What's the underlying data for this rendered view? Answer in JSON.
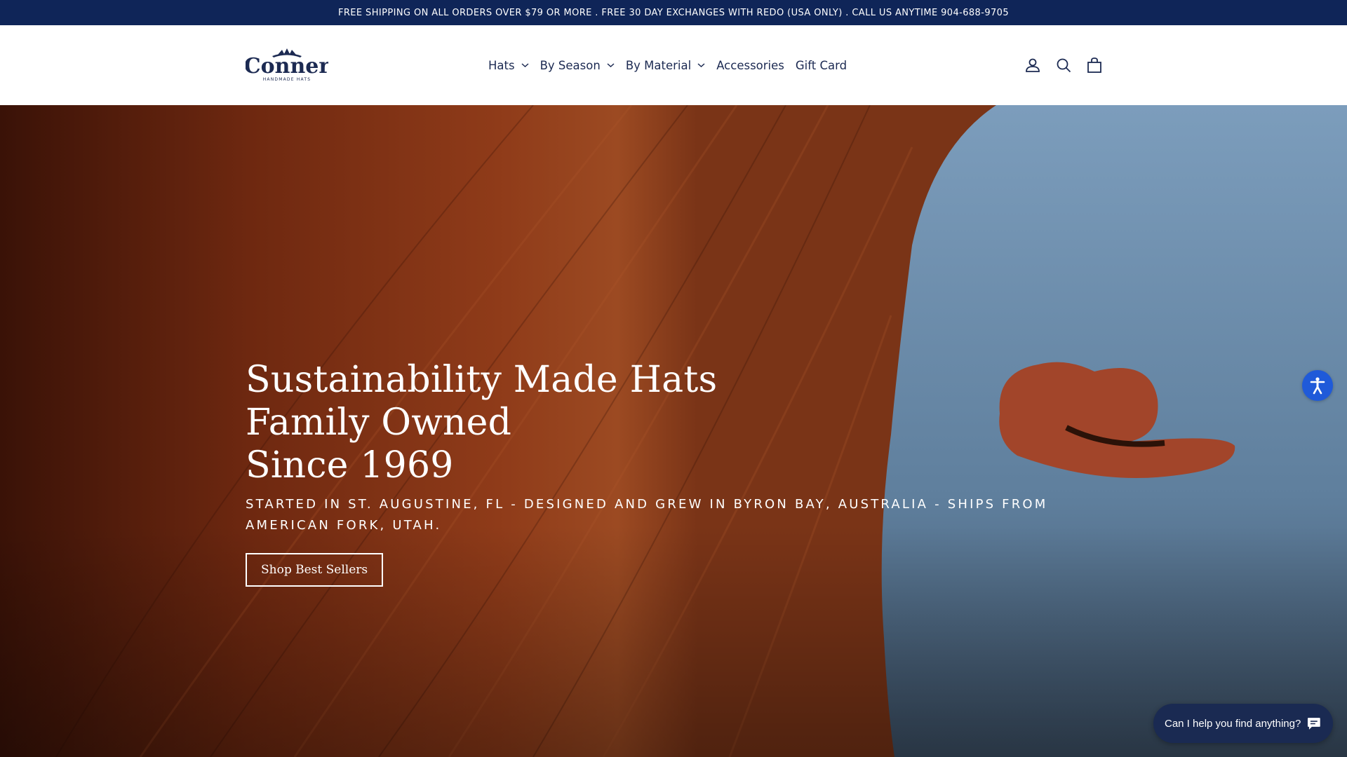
{
  "announcement": {
    "text": "FREE SHIPPING ON ALL ORDERS OVER $79 OR MORE . FREE 30 DAY EXCHANGES WITH REDO (USA ONLY) . CALL US ANYTIME 904-688-9705"
  },
  "brand": {
    "name": "Conner",
    "tagline": "HANDMADE HATS"
  },
  "nav": {
    "items": [
      {
        "label": "Hats",
        "has_dropdown": true
      },
      {
        "label": "By Season",
        "has_dropdown": true
      },
      {
        "label": "By Material",
        "has_dropdown": true
      },
      {
        "label": "Accessories",
        "has_dropdown": false
      },
      {
        "label": "Gift Card",
        "has_dropdown": false
      }
    ]
  },
  "header_icons": [
    "account-icon",
    "search-icon",
    "cart-icon"
  ],
  "hero": {
    "title_lines": [
      "Sustainability Made Hats",
      "Family Owned",
      "Since 1969"
    ],
    "subtitle": "STARTED IN ST. AUGUSTINE, FL - DESIGNED AND GREW IN BYRON BAY, AUSTRALIA - SHIPS FROM AMERICAN FORK, UTAH.",
    "cta_label": "Shop Best Sellers"
  },
  "chat_widget": {
    "prompt": "Can I help you find anything?"
  },
  "accessibility_button": {
    "icon": "accessibility-icon"
  },
  "colors": {
    "announcement_bg": "#0f2558",
    "brand_navy": "#1c2a52",
    "accessibility_blue": "#1f5ad9",
    "chat_bg": "#1a2a52"
  }
}
